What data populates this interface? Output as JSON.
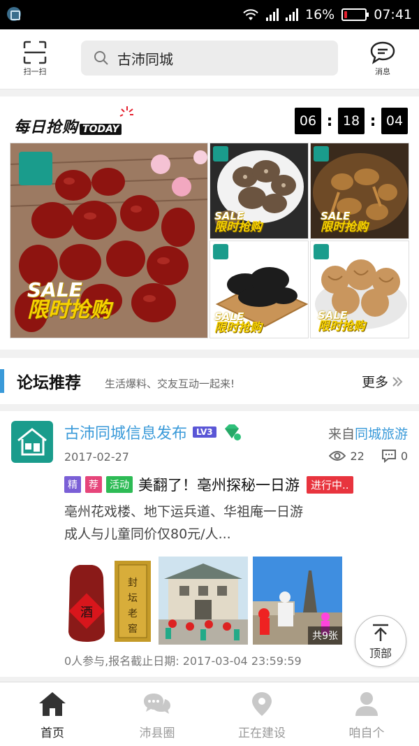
{
  "status_bar": {
    "battery_percent": "16%",
    "time": "07:41",
    "battery_level": 0.16,
    "battery_color": "#e5202e"
  },
  "header": {
    "scan_label": "扫一扫",
    "search_text": "古沛同城",
    "message_label": "消息"
  },
  "daily_deal": {
    "title_cn": "每日抢购",
    "title_en": "TODAY",
    "countdown": {
      "hours": "06",
      "minutes": "18",
      "seconds": "04"
    },
    "tiles": [
      {
        "name": "red-dates",
        "sale_en": "SALE",
        "sale_cn": "限时抢购"
      },
      {
        "name": "shiitake",
        "sale_en": "SALE",
        "sale_cn": "限时抢购"
      },
      {
        "name": "dried-mushroom",
        "sale_en": "SALE",
        "sale_cn": "限时抢购"
      },
      {
        "name": "black-fungus",
        "sale_en": "SALE",
        "sale_cn": "限时抢购"
      },
      {
        "name": "walnuts",
        "sale_en": "SALE",
        "sale_cn": "限时抢购"
      }
    ]
  },
  "forum": {
    "title": "论坛推荐",
    "subtitle": "生活爆料、交友互动一起来!",
    "more_label": "更多"
  },
  "post": {
    "author": "古沛同城信息发布",
    "level": "LV3",
    "from_prefix": "来自",
    "from_link": "同城旅游",
    "date": "2017-02-27",
    "views": "22",
    "comments": "0",
    "tags": [
      "精",
      "荐",
      "活动"
    ],
    "headline": "美翻了！亳州探秘一日游",
    "status": "进行中..",
    "excerpt_line1": "亳州花戏楼、地下运兵道、华祖庵一日游",
    "excerpt_line2": "成人与儿童同价仅80元/人...",
    "photo_count": "共9张",
    "photo3_text1": "封",
    "photo3_text2": "坛",
    "photo3_text3": "老",
    "photo3_text4": "窖",
    "photo1_text": "酒",
    "footer": "0人参与,报名截止日期: 2017-03-04 23:59:59"
  },
  "to_top_label": "顶部",
  "tabs": [
    {
      "label": "首页",
      "icon": "home-icon",
      "active": true
    },
    {
      "label": "沛县圈",
      "icon": "chat-icon",
      "active": false
    },
    {
      "label": "正在建设",
      "icon": "location-icon",
      "active": false
    },
    {
      "label": "咱自个",
      "icon": "user-icon",
      "active": false
    }
  ]
}
